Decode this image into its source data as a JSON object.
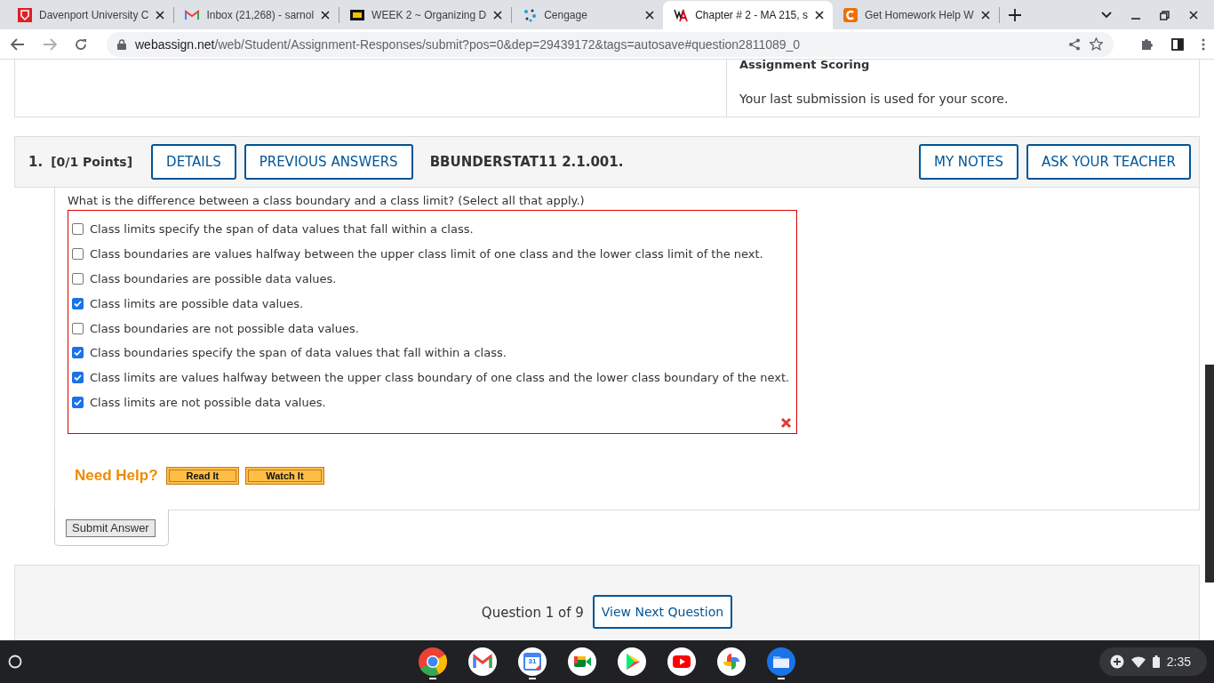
{
  "browser": {
    "tabs": [
      {
        "kind": "davenport",
        "title": "Davenport University C",
        "selected": false
      },
      {
        "kind": "gmail",
        "title": "Inbox (21,268) - sarnol",
        "selected": false
      },
      {
        "kind": "blackboard",
        "title": "WEEK 2 ~ Organizing D",
        "selected": false
      },
      {
        "kind": "cengage",
        "title": "Cengage",
        "selected": false
      },
      {
        "kind": "webassign",
        "title": "Chapter # 2 - MA 215, s",
        "selected": true
      },
      {
        "kind": "chegg",
        "title": "Get Homework Help W",
        "selected": false
      }
    ],
    "url_host": "webassign.net",
    "url_path": "/web/Student/Assignment-Responses/submit?pos=0&dep=29439172&tags=autosave#question2811089_0"
  },
  "scoring": {
    "heading": "Assignment Scoring",
    "note": "Your last submission is used for your score."
  },
  "question": {
    "number": "1.",
    "points": "[0/1 Points]",
    "buttons_left": [
      "DETAILS",
      "PREVIOUS ANSWERS"
    ],
    "code": "BBUNDERSTAT11 2.1.001.",
    "buttons_right": [
      "MY NOTES",
      "ASK YOUR TEACHER"
    ],
    "prompt": "What is the difference between a class boundary and a class limit? (Select all that apply.)",
    "options": [
      {
        "label": "Class limits specify the span of data values that fall within a class.",
        "checked": false
      },
      {
        "label": "Class boundaries are values halfway between the upper class limit of one class and the lower class limit of the next.",
        "checked": false
      },
      {
        "label": "Class boundaries are possible data values.",
        "checked": false
      },
      {
        "label": "Class limits are possible data values.",
        "checked": true
      },
      {
        "label": "Class boundaries are not possible data values.",
        "checked": false
      },
      {
        "label": "Class boundaries specify the span of data values that fall within a class.",
        "checked": true
      },
      {
        "label": "Class limits are values halfway between the upper class boundary of one class and the lower class boundary of the next.",
        "checked": true
      },
      {
        "label": "Class limits are not possible data values.",
        "checked": true
      }
    ],
    "correct": false,
    "help_label": "Need Help?",
    "help_buttons": [
      "Read It",
      "Watch It"
    ],
    "submit": "Submit Answer"
  },
  "navigation": {
    "position": "Question 1 of 9",
    "next": "View Next Question"
  },
  "shelf": {
    "apps": [
      {
        "kind": "chrome",
        "running": true
      },
      {
        "kind": "gmail",
        "running": false
      },
      {
        "kind": "calendar",
        "running": true
      },
      {
        "kind": "meet",
        "running": false
      },
      {
        "kind": "play",
        "running": false
      },
      {
        "kind": "youtube",
        "running": false
      },
      {
        "kind": "photos",
        "running": false
      },
      {
        "kind": "files",
        "running": true
      }
    ],
    "calendar_day": "31",
    "time": "2:35"
  }
}
